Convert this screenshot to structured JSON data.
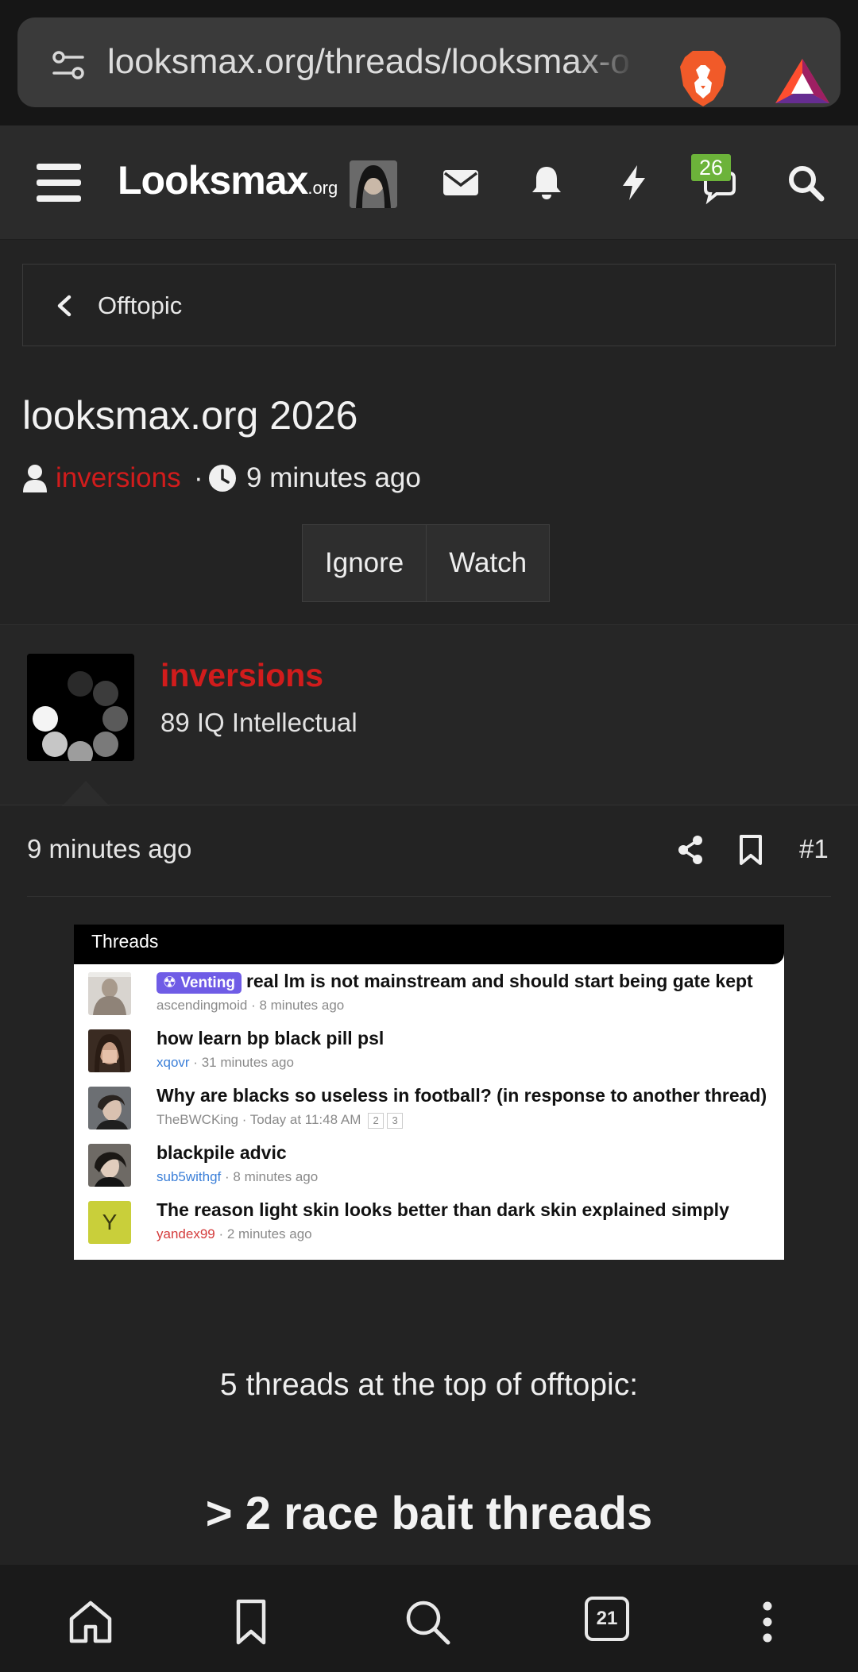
{
  "browser": {
    "url": "looksmax.org/threads/looksmax-o"
  },
  "header": {
    "logo_main": "Looksmax",
    "logo_suffix": ".org",
    "chat_badge_count": "26",
    "icons": [
      "menu-icon",
      "mail-icon",
      "bell-icon",
      "lightning-icon",
      "chat-icon",
      "search-icon"
    ]
  },
  "breadcrumb": {
    "label": "Offtopic"
  },
  "thread": {
    "title": "looksmax.org 2026",
    "author": "inversions",
    "separator": "·",
    "time": "9 minutes ago",
    "buttons": {
      "ignore": "Ignore",
      "watch": "Watch"
    }
  },
  "post": {
    "author": "inversions",
    "author_title": "89 IQ Intellectual",
    "time": "9 minutes ago",
    "number": "#1",
    "caption": "5 threads at the top of offtopic:",
    "heading": "> 2 race bait threads",
    "next_line_partial": "> ... ... ... ... ..."
  },
  "embed": {
    "header": "Threads",
    "threads": [
      {
        "tag": "Venting",
        "title": "real lm is not mainstream and should start being gate kept",
        "user": "ascendingmoid",
        "user_color": "#8a8a8a",
        "time": "8 minutes ago",
        "pages": []
      },
      {
        "tag": "",
        "title": "how learn bp black pill psl",
        "user": "xqovr",
        "user_color": "#3b7fd8",
        "time": "31 minutes ago",
        "pages": []
      },
      {
        "tag": "",
        "title": "Why are blacks so useless in football? (in response to another thread)",
        "user": "TheBWCKing",
        "user_color": "#8a8a8a",
        "time": "Today at 11:48 AM",
        "pages": [
          "2",
          "3"
        ]
      },
      {
        "tag": "",
        "title": "blackpile advic",
        "user": "sub5withgf",
        "user_color": "#3b7fd8",
        "time": "8 minutes ago",
        "pages": []
      },
      {
        "tag": "",
        "title": "The reason light skin looks better than dark skin explained simply",
        "user": "yandex99",
        "user_color": "#d43b3b",
        "time": "2 minutes ago",
        "pages": [],
        "avatar_letter": "Y"
      }
    ]
  },
  "bottom_nav": {
    "tab_count": "21"
  },
  "colors": {
    "author_red": "#d11c1c",
    "background": "#232323",
    "badge_green": "#6cb33a",
    "venting_purple": "#6f5ce6"
  }
}
